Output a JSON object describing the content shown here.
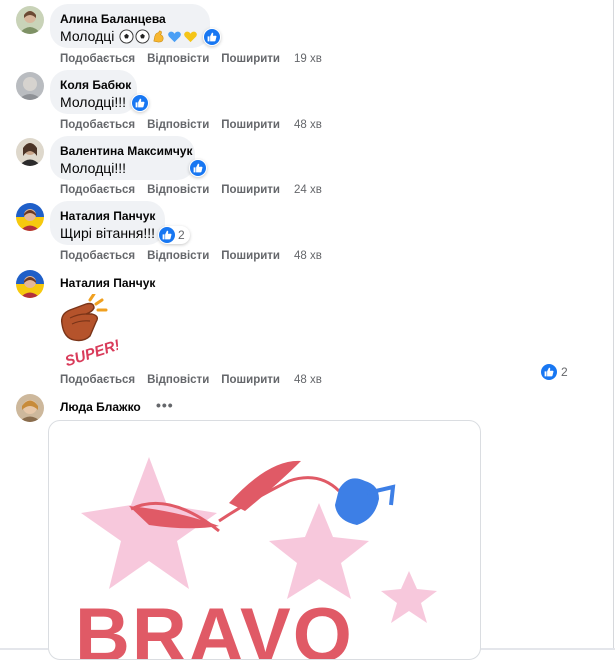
{
  "colors": {
    "accent": "#1877f2",
    "bubble": "#f0f2f5",
    "secondary_text": "#65676b",
    "gif_pink": "#e05a66",
    "gif_blue": "#3d7fe6"
  },
  "actions": {
    "like": "Подобається",
    "reply": "Відповісти",
    "share": "Поширити"
  },
  "comments": [
    {
      "author": "Алина Баланцева",
      "text": "Молодці",
      "emojis": [
        "soccer-ball",
        "soccer-ball",
        "flexed-biceps",
        "blue-heart",
        "yellow-heart"
      ],
      "time": "19 хв"
    },
    {
      "author": "Коля Бабюк",
      "text": "Молодці!!!",
      "time": "48 хв"
    },
    {
      "author": "Валентина Максимчук",
      "text": "Молодці!!!",
      "time": "24 хв"
    },
    {
      "author": "Наталия Панчук",
      "text": "Щирі вітання!!!",
      "reaction_count": "2",
      "time": "48 хв"
    },
    {
      "author": "Наталия Панчук",
      "sticker": "clapping-hands-super-sticker",
      "sticker_text": "SUPER!",
      "reaction_count": "2",
      "time": "48 хв"
    },
    {
      "author": "Люда Блажко",
      "gif": "bravo-tulip-gif",
      "gif_text": "BRAVO"
    }
  ]
}
